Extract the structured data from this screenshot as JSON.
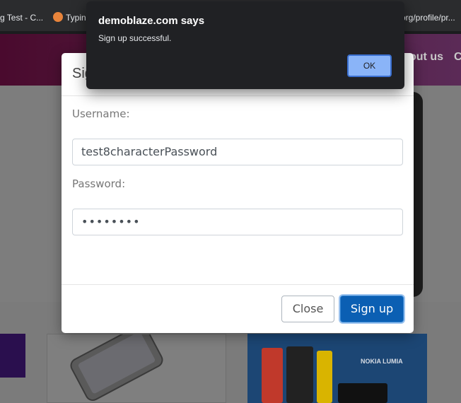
{
  "browser": {
    "bookmarks": [
      {
        "label": "g Test - C..."
      },
      {
        "label": "Typin"
      },
      {
        "label": "org/profile/pr..."
      }
    ]
  },
  "site": {
    "nav": {
      "about_label": "out us",
      "cart_label": "C"
    },
    "promo_text": "NOKIA LUMIA"
  },
  "signup_modal": {
    "title": "Sig",
    "username_label": "Username:",
    "username_value": "test8characterPassword",
    "password_label": "Password:",
    "password_value": "••••••••",
    "close_label": "Close",
    "signup_label": "Sign up"
  },
  "alert": {
    "title": "demoblaze.com says",
    "message": "Sign up successful.",
    "ok_label": "OK"
  }
}
